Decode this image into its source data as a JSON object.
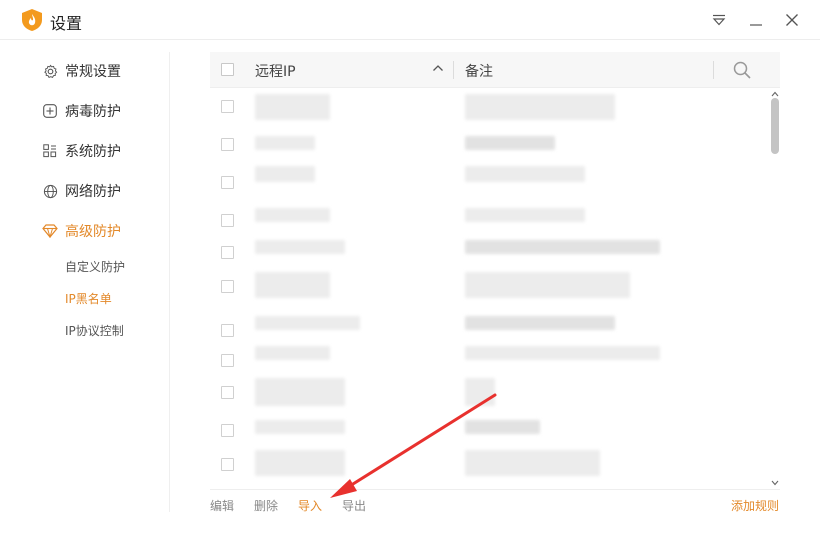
{
  "window": {
    "title": "设置",
    "logo_icon": "shield-flame-logo",
    "controls": [
      "menu-icon",
      "minimize-icon",
      "close-icon"
    ]
  },
  "sidebar": {
    "items": [
      {
        "label": "常规设置",
        "icon": "gear-icon"
      },
      {
        "label": "病毒防护",
        "icon": "plus-box-icon"
      },
      {
        "label": "系统防护",
        "icon": "grid-icon"
      },
      {
        "label": "网络防护",
        "icon": "globe-icon"
      },
      {
        "label": "高级防护",
        "icon": "diamond-icon",
        "active": true
      }
    ],
    "sub_items": [
      {
        "label": "自定义防护"
      },
      {
        "label": "IP黑名单",
        "active": true
      },
      {
        "label": "IP协议控制"
      }
    ]
  },
  "table": {
    "columns": {
      "ip": "远程IP",
      "note": "备注"
    },
    "sort_icon": "chevron-up-icon",
    "search_icon": "search-icon",
    "rows_blurred": true
  },
  "footer": {
    "edit": "编辑",
    "delete": "删除",
    "import": "导入",
    "export": "导出",
    "add_rule": "添加规则"
  },
  "colors": {
    "accent": "#e3892a",
    "annotation_arrow": "#e8312e"
  }
}
